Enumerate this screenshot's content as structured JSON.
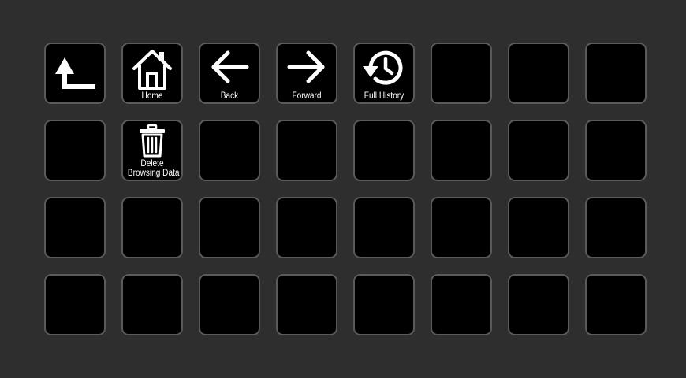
{
  "keys": {
    "up": {
      "icon": "up-arrow-corner-icon"
    },
    "home": {
      "label": "Home",
      "icon": "home-icon"
    },
    "back": {
      "label": "Back",
      "icon": "arrow-left-icon"
    },
    "forward": {
      "label": "Forward",
      "icon": "arrow-right-icon"
    },
    "history": {
      "label": "Full History",
      "icon": "history-icon"
    },
    "delete": {
      "label_line1": "Delete",
      "label_line2": "Browsing Data",
      "icon": "trash-icon"
    }
  },
  "colors": {
    "background": "#2e2e2e",
    "key_fill": "#000000",
    "key_border": "#5a5a5a",
    "icon": "#ffffff"
  }
}
